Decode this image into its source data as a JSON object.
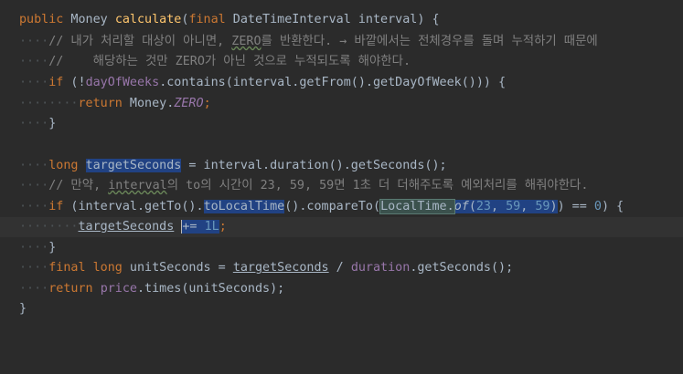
{
  "editor": {
    "lines": [
      [
        "public",
        " Money ",
        "calculate",
        "(",
        "final",
        " DateTimeInterval interval) {"
      ],
      [
        "// 내가 처리할 대상이 아니면, ",
        "ZERO",
        "를 반환한다. → 바깥에서는 전체경우를 돌며 누적하기 때문에"
      ],
      [
        "//    해당하는 것만 ZERO가 아닌 것으로 누적되도록 해야한다."
      ],
      [
        "if",
        " (!",
        "dayOfWeeks",
        ".contains(interval.getFrom().getDayOfWeek())) {"
      ],
      [
        "return",
        " Money.",
        "ZERO",
        ";"
      ],
      [
        "}"
      ],
      [
        ""
      ],
      [
        "long",
        " ",
        "targetSeconds",
        " = interval.duration().getSeconds();"
      ],
      [
        "// 만약, ",
        "interval",
        "의 to의 시간이 23, 59, 59면 1초 더 더해주도록 예외처리를 해줘야한다."
      ],
      [
        "if",
        " (interval.getTo().",
        "toLocalTime",
        "().compareTo(",
        "LocalTime.",
        "of",
        "(",
        "23",
        ", ",
        "59",
        ", ",
        "59",
        ")",
        ") == ",
        "0",
        ") {"
      ],
      [
        "targetSeconds",
        " ",
        "+=",
        " ",
        "1L",
        ";"
      ],
      [
        "}"
      ],
      [
        "final",
        " ",
        "long",
        " unitSeconds = ",
        "targetSeconds",
        " / ",
        "duration",
        ".getSeconds();"
      ],
      [
        "return",
        " ",
        "price",
        ".times(unitSeconds);"
      ],
      [
        "}"
      ]
    ]
  }
}
